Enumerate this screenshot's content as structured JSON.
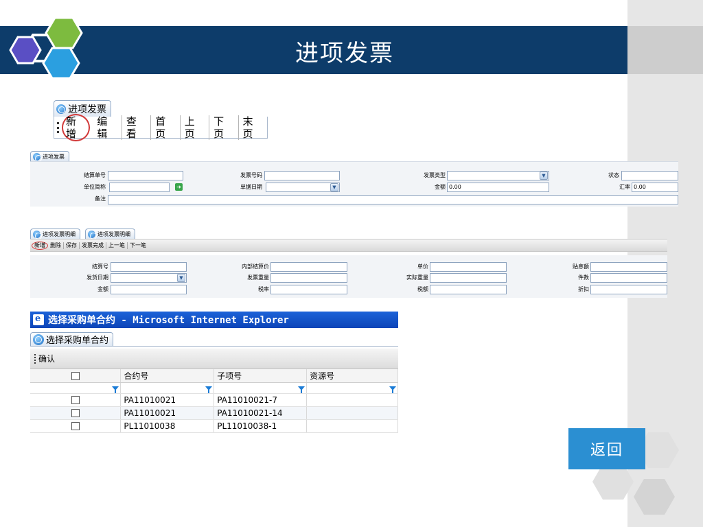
{
  "header": {
    "title": "进项发票"
  },
  "main_tab": {
    "label": "进项发票"
  },
  "main_toolbar": {
    "buttons": [
      "新增",
      "编辑",
      "查看",
      "首页",
      "上页",
      "下页",
      "末页"
    ]
  },
  "invoice_form": {
    "tab": "进项发票",
    "fields": {
      "settlement_no": {
        "label": "结算单号",
        "value": ""
      },
      "invoice_no": {
        "label": "发票号码",
        "value": ""
      },
      "invoice_type": {
        "label": "发票类型",
        "value": ""
      },
      "status": {
        "label": "状态",
        "value": ""
      },
      "unit_short": {
        "label": "单位简称",
        "value": ""
      },
      "doc_date": {
        "label": "单据日期",
        "value": ""
      },
      "amount": {
        "label": "金额",
        "value": "0.00"
      },
      "exchange_rate": {
        "label": "汇率",
        "value": "0.00"
      },
      "remark": {
        "label": "备注",
        "value": ""
      }
    }
  },
  "detail_section": {
    "tabs": [
      "进项发票明细",
      "进项发票明细"
    ],
    "toolbar": [
      "新增",
      "删除",
      "保存",
      "发票完成",
      "上一笔",
      "下一笔"
    ],
    "fields": {
      "settle_no": {
        "label": "结算号",
        "value": ""
      },
      "internal_price": {
        "label": "内部结算价",
        "value": ""
      },
      "unit_price": {
        "label": "单价",
        "value": ""
      },
      "discount_amount": {
        "label": "贴息额",
        "value": ""
      },
      "ship_date": {
        "label": "发货日期",
        "value": ""
      },
      "invoice_weight": {
        "label": "发票重量",
        "value": ""
      },
      "actual_weight": {
        "label": "实际重量",
        "value": ""
      },
      "pieces": {
        "label": "件数",
        "value": ""
      },
      "amount": {
        "label": "金额",
        "value": ""
      },
      "tax_rate": {
        "label": "税率",
        "value": ""
      },
      "tax_amount": {
        "label": "税额",
        "value": ""
      },
      "rebate": {
        "label": "折扣",
        "value": ""
      }
    }
  },
  "popup": {
    "window_title": "选择采购单合约 - Microsoft Internet Explorer",
    "tab": "选择采购单合约",
    "toolbar": {
      "confirm": "确认"
    },
    "columns": [
      "合约号",
      "子项号",
      "资源号"
    ],
    "rows": [
      {
        "contract": "PA11010021",
        "sub_item": "PA11010021-7",
        "resource": ""
      },
      {
        "contract": "PA11010021",
        "sub_item": "PA11010021-14",
        "resource": ""
      },
      {
        "contract": "PL11010038",
        "sub_item": "PL11010038-1",
        "resource": ""
      }
    ]
  },
  "back_button": {
    "label": "返回"
  },
  "colors": {
    "header": "#0d3c6a",
    "accent": "#2b8fd2",
    "highlight_circle": "#d23a3a",
    "ie_title": "#0c44b8"
  }
}
